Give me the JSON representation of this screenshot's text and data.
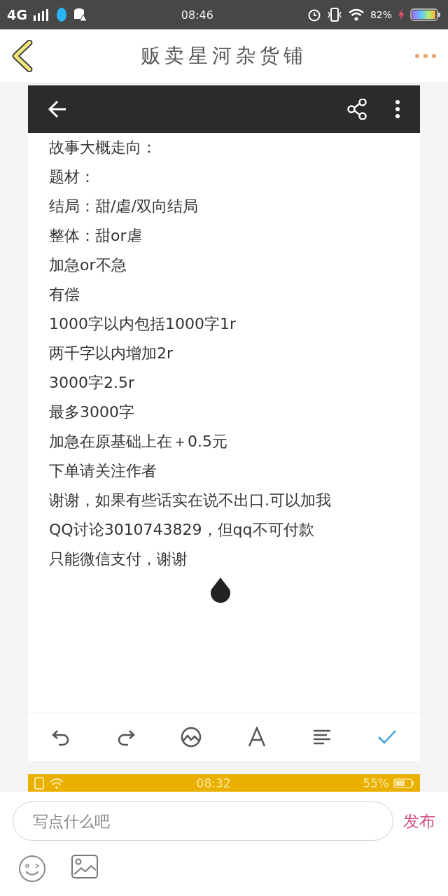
{
  "status_bar": {
    "network": "4G",
    "time": "08:46",
    "battery": "82%"
  },
  "header": {
    "title": "贩卖星河杂货铺"
  },
  "screenshot": {
    "lines": [
      "故事大概走向：",
      "题材：",
      "结局：甜/虐/双向结局",
      "整体：甜or虐",
      "加急or不急",
      "有偿",
      "1000字以内包括1000字1r",
      "两千字以内增加2r",
      "3000字2.5r",
      "最多3000字",
      "加急在原基础上在＋0.5元",
      "下单请关注作者",
      "谢谢，如果有些话实在说不出口.可以加我",
      "QQ讨论3010743829，但qq不可付款",
      "只能微信支付，谢谢"
    ],
    "status_bar": {
      "time": "08:32",
      "battery": "55%"
    }
  },
  "composer": {
    "placeholder": "写点什么吧",
    "send": "发布"
  }
}
